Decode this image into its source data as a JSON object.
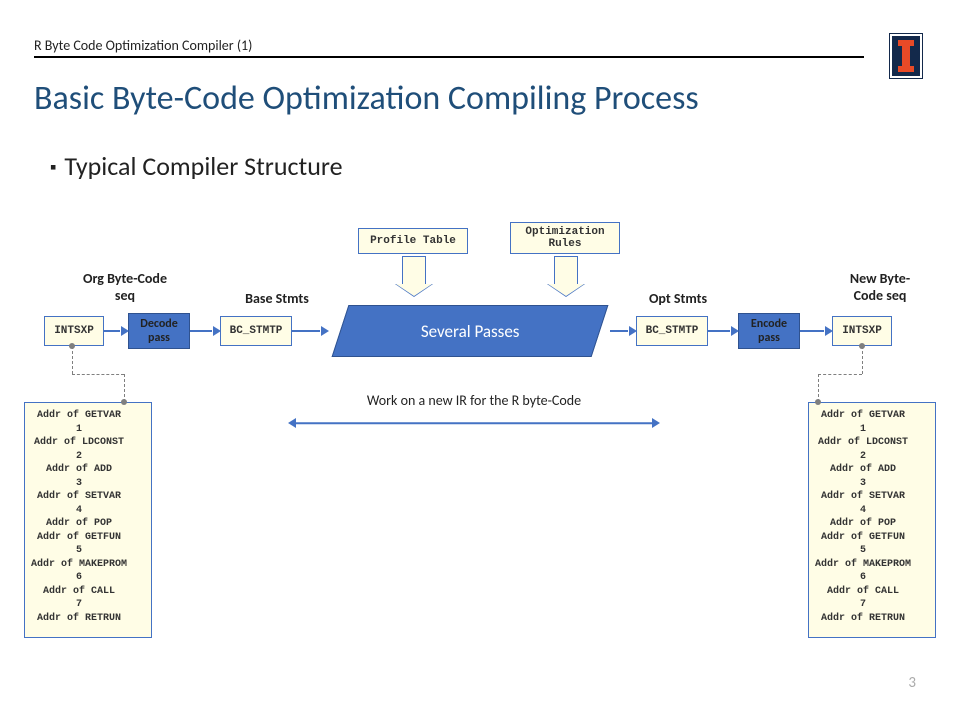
{
  "header": {
    "label": "R Byte Code Optimization Compiler (1)"
  },
  "title": "Basic Byte-Code Optimization Compiling Process",
  "bullet": "Typical Compiler Structure",
  "page_number": "3",
  "diagram": {
    "headers": {
      "org_seq": "Org Byte-Code\nseq",
      "base_stmts": "Base Stmts",
      "opt_stmts": "Opt Stmts",
      "new_seq": "New Byte-\nCode seq"
    },
    "boxes": {
      "intsxp_left": "INTSXP",
      "decode_pass": "Decode\npass",
      "bc_stmtp_left": "BC_STMTP",
      "several_passes": "Several Passes",
      "bc_stmtp_right": "BC_STMTP",
      "encode_pass": "Encode\npass",
      "intsxp_right": "INTSXP",
      "profile_table": "Profile Table",
      "optimization_rules": "Optimization\nRules"
    },
    "annotation": "Work on a new IR for the R byte-Code",
    "code_left": "Addr of GETVAR\n1\nAddr of LDCONST\n2\nAddr of ADD\n3\nAddr of SETVAR\n4\nAddr of POP\nAddr of GETFUN\n5\nAddr of MAKEPROM\n6\nAddr of CALL\n7\nAddr of RETRUN",
    "code_right": "Addr of GETVAR\n1\nAddr of LDCONST\n2\nAddr of ADD\n3\nAddr of SETVAR\n4\nAddr of POP\nAddr of GETFUN\n5\nAddr of MAKEPROM\n6\nAddr of CALL\n7\nAddr of RETRUN"
  },
  "colors": {
    "accent": "#4472c4",
    "box_fill": "#fffde6"
  }
}
